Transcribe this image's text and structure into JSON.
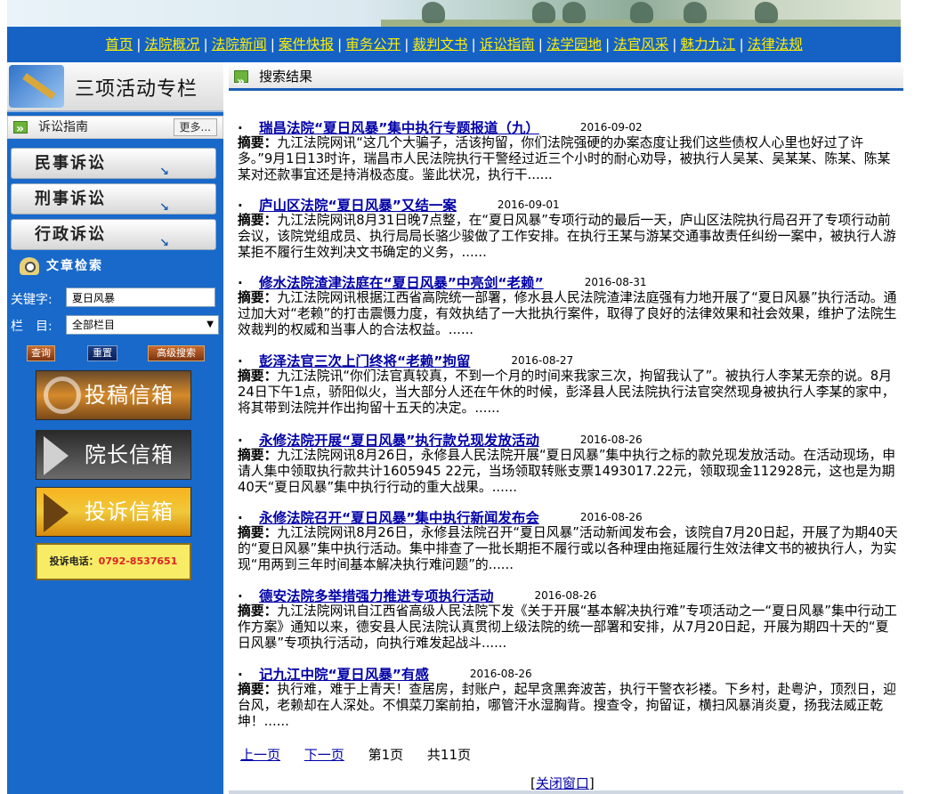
{
  "nav": [
    "首页",
    "法院概况",
    "法院新闻",
    "案件快报",
    "审务公开",
    "裁判文书",
    "诉讼指南",
    "法学园地",
    "法官风采",
    "魅力九江",
    "法律法规"
  ],
  "sidebar": {
    "column_title": "三项活动专栏",
    "guide_title": "诉讼指南",
    "more_label": "更多...",
    "guide_items": [
      "民事诉讼",
      "刑事诉讼",
      "行政诉讼"
    ],
    "search_title": "文章检索",
    "keyword_label": "关键字:",
    "keyword_value": "夏日风暴",
    "column_label": "栏　目:",
    "column_value": "全部栏目",
    "query_label": "查询",
    "reset_label": "重置",
    "advanced_label": "高级搜索",
    "mailbox_submit": "投稿信箱",
    "mailbox_president": "院长信箱",
    "mailbox_complaint": "投诉信箱",
    "phone_label": "投诉电话：",
    "phone_number": "0792-8537651"
  },
  "main": {
    "title": "搜索结果",
    "summary_label": "摘要：",
    "results": [
      {
        "title": "瑞昌法院“夏日风暴”集中执行专题报道（九）",
        "date": "2016-09-02",
        "summary": "九江法院网讯“这几个大骗子，活该拘留，你们法院强硬的办案态度让我们这些债权人心里也好过了许多。”9月1日13时许，瑞昌市人民法院执行干警经过近三个小时的耐心劝导，被执行人吴某、吴某某、陈某、陈某某对还款事宜还是持消极态度。鉴此状况，执行干......"
      },
      {
        "title": "庐山区法院“夏日风暴”又结一案",
        "date": "2016-09-01",
        "summary": "九江法院网讯8月31日晚7点整，在“夏日风暴”专项行动的最后一天，庐山区法院执行局召开了专项行动前会议，该院党组成员、执行局局长骆少骏做了工作安排。在执行王某与游某交通事故责任纠纷一案中，被执行人游某拒不履行生效判决文书确定的义务，......"
      },
      {
        "title": "修水法院渣津法庭在“夏日风暴”中亮剑“老赖”",
        "date": "2016-08-31",
        "summary": "九江法院网讯根据江西省高院统一部署，修水县人民法院渣津法庭强有力地开展了“夏日风暴”执行活动。通过加大对“老赖”的打击震慑力度，有效执结了一大批执行案件，取得了良好的法律效果和社会效果，维护了法院生效裁判的权威和当事人的合法权益。......"
      },
      {
        "title": "彭泽法官三次上门终将“老赖”拘留",
        "date": "2016-08-27",
        "summary": "九江法院讯“你们法官真较真，不到一个月的时间来我家三次，拘留我认了”。被执行人李某无奈的说。8月24日下午1点，骄阳似火，当大部分人还在午休的时候，彭泽县人民法院执行法官突然现身被执行人李某的家中，将其带到法院并作出拘留十五天的决定。......"
      },
      {
        "title": "永修法院开展“夏日风暴”执行款兑现发放活动",
        "date": "2016-08-26",
        "summary": "九江法院网讯8月26日，永修县人民法院开展“夏日风暴”集中执行之标的款兑现发放活动。在活动现场，申请人集中领取执行款共计1605945 22元，当场领取转账支票1493017.22元，领取现金112928元，这也是为期40天“夏日风暴”集中执行行动的重大战果。......"
      },
      {
        "title": "永修法院召开“夏日风暴”集中执行新闻发布会",
        "date": "2016-08-26",
        "summary": "九江法院网讯8月26日，永修县法院召开“夏日风暴”活动新闻发布会，该院自7月20日起，开展了为期40天的“夏日风暴”集中执行活动。集中排查了一批长期拒不履行或以各种理由拖延履行生效法律文书的被执行人，为实现“用两到三年时间基本解决执行难问题”的......"
      },
      {
        "title": "德安法院多举措强力推进专项执行活动",
        "date": "2016-08-26",
        "summary": "九江法院网讯自江西省高级人民法院下发《关于开展“基本解决执行难”专项活动之一“夏日风暴”集中行动工作方案》通知以来，德安县人民法院认真贯彻上级法院的统一部署和安排，从7月20日起，开展为期四十天的“夏日风暴”专项执行活动，向执行难发起战斗......"
      },
      {
        "title": "记九江中院“夏日风暴”有感",
        "date": "2016-08-26",
        "summary": "执行难，难于上青天！查居房，封账户，起早贪黑奔波苦，执行干警衣衫褛。下乡村，赴粤沪，顶烈日，迎台风，老赖却在人深处。不惧菜刀案前拍，哪管汗水湿胸背。搜查令，拘留证，横扫风暴消炎夏，扬我法威正乾坤！......"
      }
    ],
    "pager": {
      "prev": "上一页",
      "next": "下一页",
      "current": "第1页",
      "total": "共11页"
    },
    "close_label": "关闭窗口"
  },
  "colors": {
    "nav_bg": "#1562c4",
    "nav_link": "#ffee00",
    "sidebar_bg": "#1869c9",
    "link": "#0000a8"
  }
}
